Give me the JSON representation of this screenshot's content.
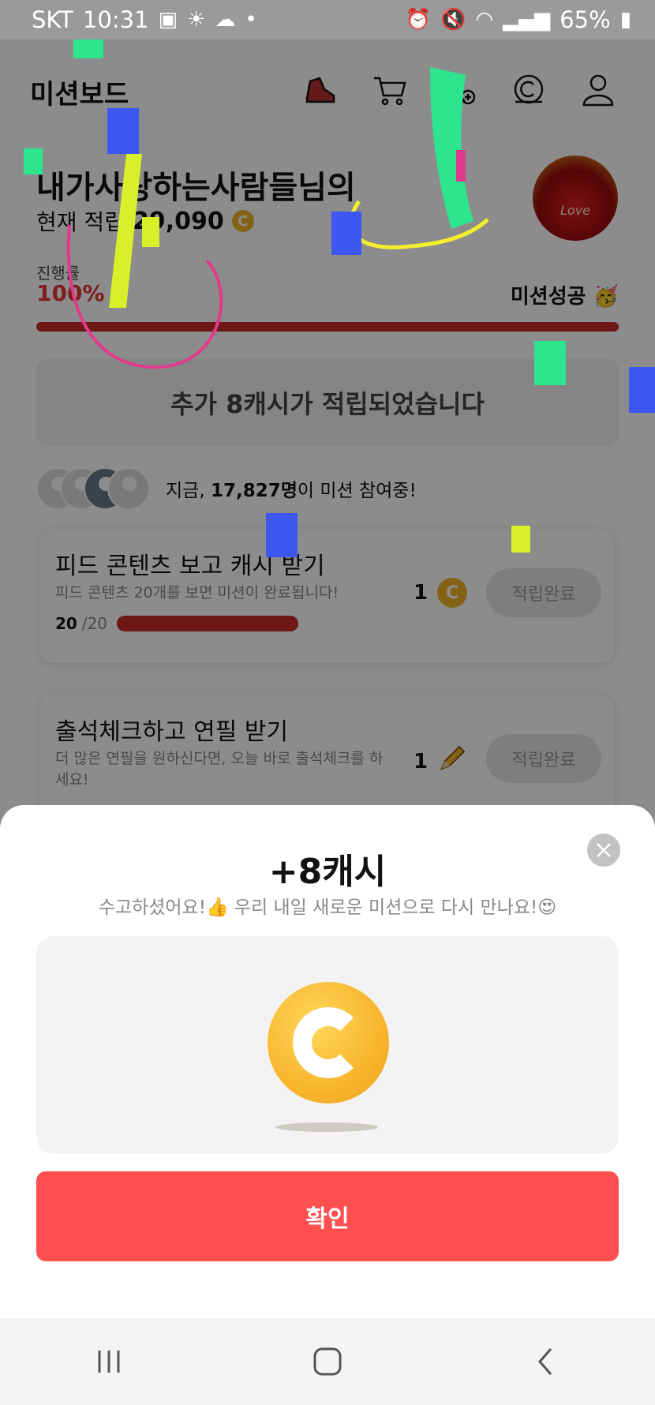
{
  "status_bar": {
    "carrier": "SKT",
    "time": "10:31",
    "battery": "65%"
  },
  "header": {
    "title": "미션보드",
    "icons": [
      "shoe-icon",
      "cart-icon",
      "add-user-icon",
      "cash-icon",
      "profile-icon"
    ]
  },
  "user": {
    "name": "내가사랑하는사람들님의",
    "points_label": "현재 적립",
    "points_value": "29,090",
    "avatar_label": "Love"
  },
  "progress": {
    "label": "진행률",
    "value": "100%",
    "fraction": 1.0,
    "status": "미션성공 🥳"
  },
  "notice": {
    "text": "추가 8캐시가 적립되었습니다"
  },
  "participants": {
    "prefix": "지금, ",
    "count": "17,827명",
    "suffix": "이 미션 참여중!"
  },
  "missions": [
    {
      "title": "피드 콘텐츠 보고 캐시 받기",
      "desc": "피드 콘텐츠 20개를 보면 미션이 완료됩니다!",
      "progress_done": "20",
      "progress_total": "/20",
      "reward": "1",
      "reward_icon": "coin-icon",
      "button": "적립완료"
    },
    {
      "title": "출석체크하고 연필 받기",
      "desc": "더 많은 연필을 원하신다면, 오늘 바로 출석체크를 하세요!",
      "reward": "1",
      "reward_icon": "pencil-icon",
      "button": "적립완료"
    }
  ],
  "sheet": {
    "title": "+8캐시",
    "subtitle": "수고하셨어요!👍 우리 내일 새로운 미션으로 다시 만나요!😍",
    "confirm": "확인"
  },
  "colors": {
    "accent": "#ff4f4f",
    "progress": "#c92a2a",
    "coin": "#f0b429"
  }
}
